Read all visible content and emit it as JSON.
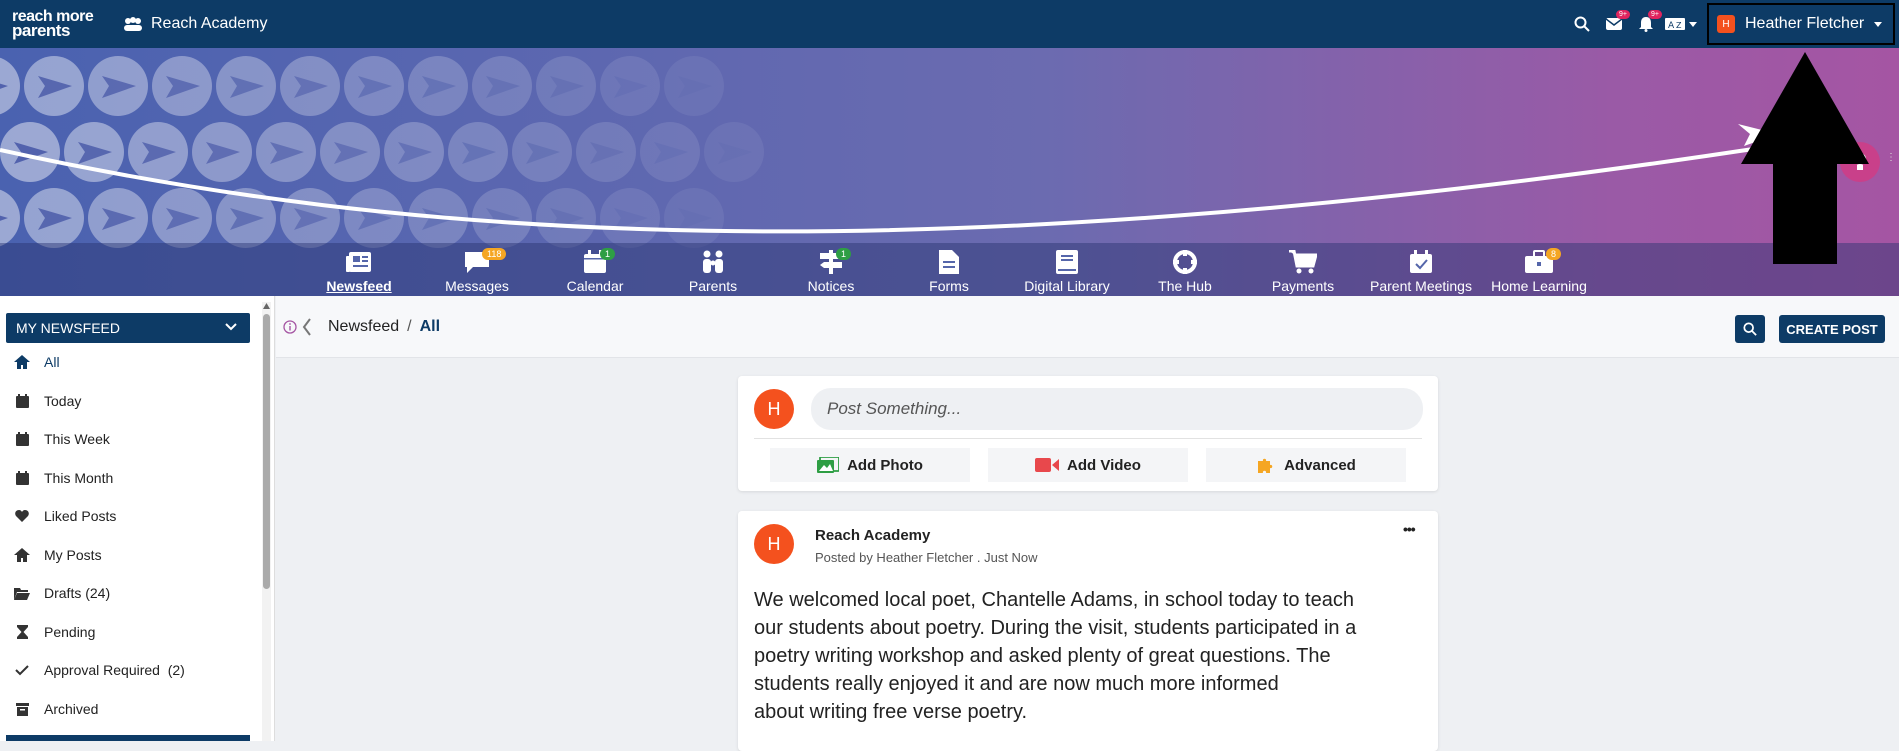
{
  "topbar": {
    "logo_line1": "reach more",
    "logo_line2": "parents",
    "school_name": "Reach Academy",
    "messages_badge": "9+",
    "notifications_badge": "9+",
    "user_initial": "H",
    "user_name": "Heather Fletcher"
  },
  "nav": [
    {
      "label": "Newsfeed",
      "badge": ""
    },
    {
      "label": "Messages",
      "badge": "118"
    },
    {
      "label": "Calendar",
      "badge": "1"
    },
    {
      "label": "Parents",
      "badge": ""
    },
    {
      "label": "Notices",
      "badge": "1"
    },
    {
      "label": "Forms",
      "badge": ""
    },
    {
      "label": "Digital Library",
      "badge": ""
    },
    {
      "label": "The Hub",
      "badge": ""
    },
    {
      "label": "Payments",
      "badge": ""
    },
    {
      "label": "Parent Meetings",
      "badge": ""
    },
    {
      "label": "Home Learning",
      "badge": "8"
    }
  ],
  "sidebar": {
    "title": "MY NEWSFEED",
    "items": [
      {
        "label": "All",
        "icon": "home-icon"
      },
      {
        "label": "Today",
        "icon": "calendar-icon"
      },
      {
        "label": "This Week",
        "icon": "calendar-icon"
      },
      {
        "label": "This Month",
        "icon": "calendar-icon"
      },
      {
        "label": "Liked Posts",
        "icon": "heart-icon"
      },
      {
        "label": "My Posts",
        "icon": "home-icon"
      },
      {
        "label": "Drafts (24)",
        "icon": "folder-icon"
      },
      {
        "label": "Pending",
        "icon": "hourglass-icon"
      },
      {
        "label": "Approval Required  (2)",
        "icon": "check-icon"
      },
      {
        "label": "Archived",
        "icon": "archive-icon"
      }
    ]
  },
  "breadcrumb": {
    "root": "Newsfeed",
    "sep": "/",
    "current": "All"
  },
  "actions": {
    "create_post": "CREATE POST"
  },
  "composer": {
    "initial": "H",
    "placeholder": "Post Something...",
    "add_photo": "Add Photo",
    "add_video": "Add Video",
    "advanced": "Advanced"
  },
  "post": {
    "initial": "H",
    "author": "Reach Academy",
    "meta": "Posted by Heather Fletcher . Just Now",
    "menu": "•••",
    "body_lines": [
      "We welcomed local poet, Chantelle Adams, in school today to teach",
      "our students about poetry. During the visit, students participated in a",
      "poetry writing workshop and asked plenty of great questions. The",
      "students really enjoyed it and are now much more informed",
      "about writing free verse poetry."
    ]
  },
  "colors": {
    "brand": "#0d3b66",
    "accent": "#f4511e"
  }
}
